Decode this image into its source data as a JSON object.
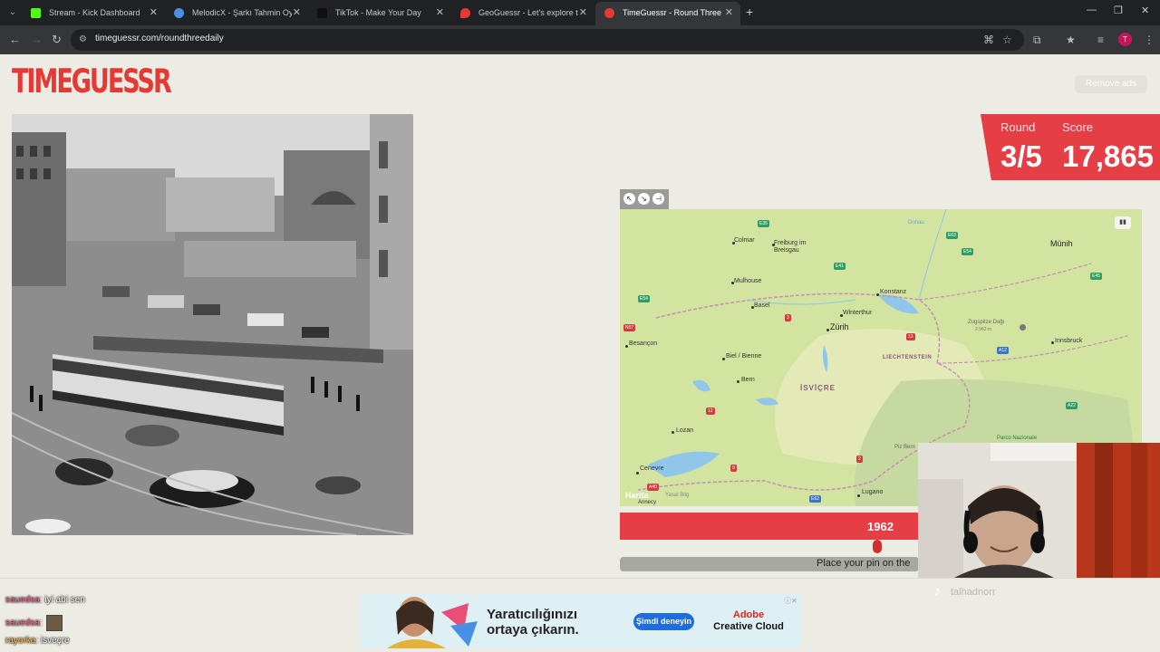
{
  "browser": {
    "tabs": [
      {
        "label": "Stream - Kick Dashboard",
        "favicon_color": "#53fc18"
      },
      {
        "label": "MelodicX - Şarkı Tahmin Oyunu",
        "favicon_color": "#4a90e2"
      },
      {
        "label": "TikTok - Make Your Day",
        "favicon_color": "#111111"
      },
      {
        "label": "GeoGuessr - Let's explore the w",
        "favicon_color": "#e53935"
      },
      {
        "label": "TimeGuessr - Round Three",
        "favicon_color": "#e53935"
      }
    ],
    "url": "timeguessr.com/roundthreedaily",
    "profile_initial": "T"
  },
  "page": {
    "logo": "TIMEGUESSR",
    "remove_ads": "Remove ads",
    "score": {
      "round_label": "Round",
      "score_label": "Score",
      "round_value": "3/5",
      "score_value": "17,865"
    },
    "year": "1962",
    "year_slider_fraction": 0.86,
    "guess_prompt": "Place your pin on the",
    "map": {
      "credit": "Harita",
      "credit_sub": "Yasal Bilg",
      "country": "İSVİÇRE",
      "country2": "LIECHTENSTEIN",
      "cities": {
        "colmar": "Colmar",
        "freiburg": "Freiburg im Breisgau",
        "mulhouse": "Mulhouse",
        "basel": "Basel",
        "besancon": "Besançon",
        "biel": "Biel / Bienne",
        "bern": "Bern",
        "zurich": "Zürih",
        "winterthur": "Winterthur",
        "konstanz": "Konstanz",
        "munih": "Münih",
        "innsbruck": "Innsbruck",
        "zugspitze": "Zugspitze Dağı",
        "zugspitze_h": "2.962 m",
        "lozan": "Lozan",
        "cenevre": "Cenevre",
        "annecy": "Annecy",
        "lugano": "Lugano",
        "parco": "Parco Nazionale",
        "pizbern": "Piz Bern",
        "donau": "Donau",
        "rhein": "Rhein"
      },
      "roads": {
        "e35": "E35",
        "e41": "E41",
        "e54": "E54",
        "n57": "N57",
        "a3": "3",
        "a13": "13",
        "a12": "A12",
        "e63": "E63",
        "e54b": "E54",
        "e45": "E45",
        "a22": "A22",
        "a12b": "12",
        "a9": "9",
        "a40": "A40",
        "a2": "2",
        "e62": "E62"
      }
    },
    "streamer": {
      "tiktok_handle": "talhadnorr"
    },
    "chat": [
      {
        "user": "sauedsa",
        "text": ": iyi abi sen"
      },
      {
        "user": "sauedsa",
        "text": ":"
      },
      {
        "user": "rayorka",
        "text": ": isveçre"
      }
    ],
    "ad": {
      "headline_line1": "Yaratıcılığınızı",
      "headline_line2": "ortaya çıkarın.",
      "button": "Şimdi deneyin",
      "brand_line1": "Adobe",
      "brand_line2": "Creative Cloud"
    }
  }
}
